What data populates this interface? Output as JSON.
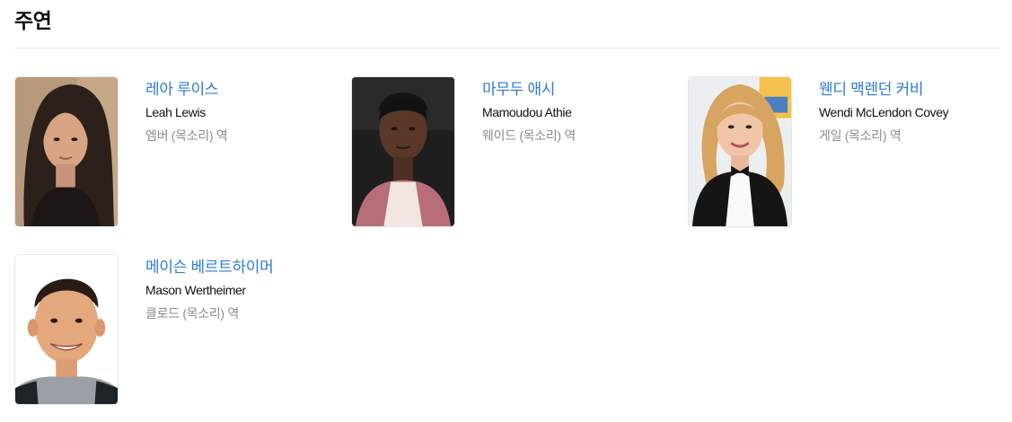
{
  "section": {
    "title": "주연"
  },
  "cast": [
    {
      "name_ko": "레아 루이스",
      "name_en": "Leah Lewis",
      "role": "엠버 (목소리) 역"
    },
    {
      "name_ko": "마무두 애시",
      "name_en": "Mamoudou Athie",
      "role": "웨이드 (목소리) 역"
    },
    {
      "name_ko": "웬디 맥렌던 커비",
      "name_en": "Wendi McLendon Covey",
      "role": "게일 (목소리) 역"
    },
    {
      "name_ko": "메이슨 베르트하이머",
      "name_en": "Mason Wertheimer",
      "role": "클로드 (목소리) 역"
    }
  ],
  "colors": {
    "link": "#2d7bd8",
    "title": "#111111",
    "secondary": "#8c8c8c"
  }
}
